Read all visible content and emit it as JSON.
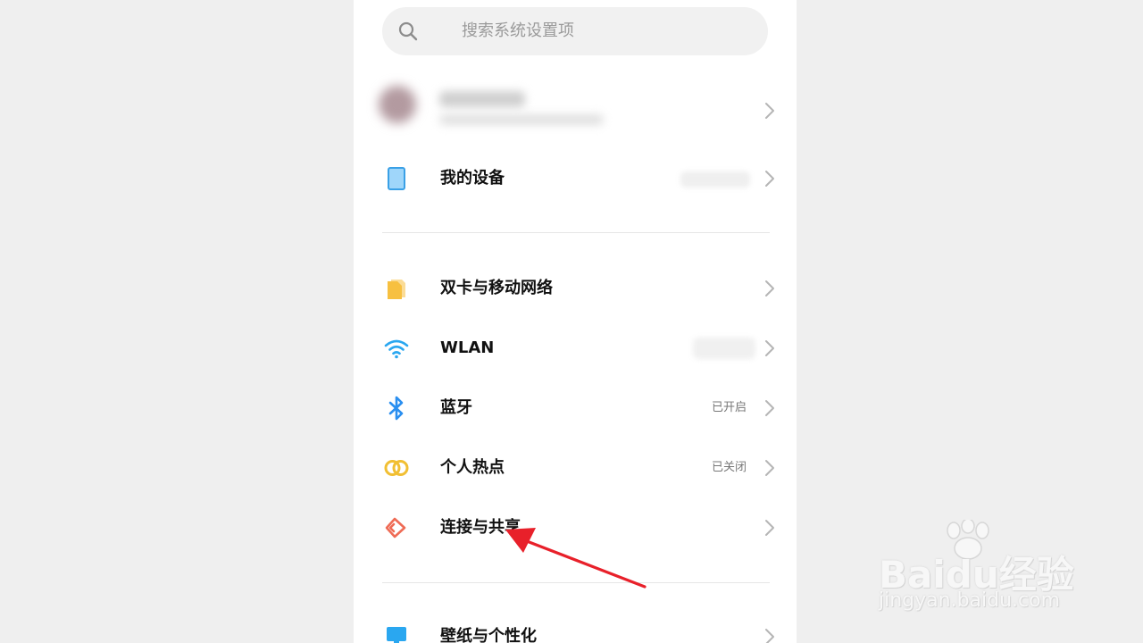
{
  "search": {
    "placeholder": "搜索系统设置项"
  },
  "my_device": {
    "label": "我的设备"
  },
  "items": [
    {
      "label": "双卡与移动网络",
      "status": ""
    },
    {
      "label": "WLAN",
      "status": ""
    },
    {
      "label": "蓝牙",
      "status": "已开启"
    },
    {
      "label": "个人热点",
      "status": "已关闭"
    },
    {
      "label": "连接与共享",
      "status": ""
    },
    {
      "label": "壁纸与个性化",
      "status": ""
    }
  ],
  "icons": {
    "search": "search-icon",
    "device": "tablet-device-icon",
    "sim": "sim-card-icon",
    "wlan": "wifi-icon",
    "bluetooth": "bluetooth-icon",
    "hotspot": "hotspot-rings-icon",
    "share": "connection-share-icon",
    "wallpaper": "wallpaper-icon",
    "chevron": "chevron-right-icon"
  },
  "colors": {
    "sim": "#f7c040",
    "wifi": "#2aa7f0",
    "bluetooth": "#2a8ff0",
    "hotspot": "#f1bf33",
    "share": "#ef6b55",
    "device": "#6cc1f5",
    "arrow": "#e8202a"
  },
  "watermark": {
    "brand": "Baidu经验",
    "url": "jingyan.baidu.com"
  }
}
